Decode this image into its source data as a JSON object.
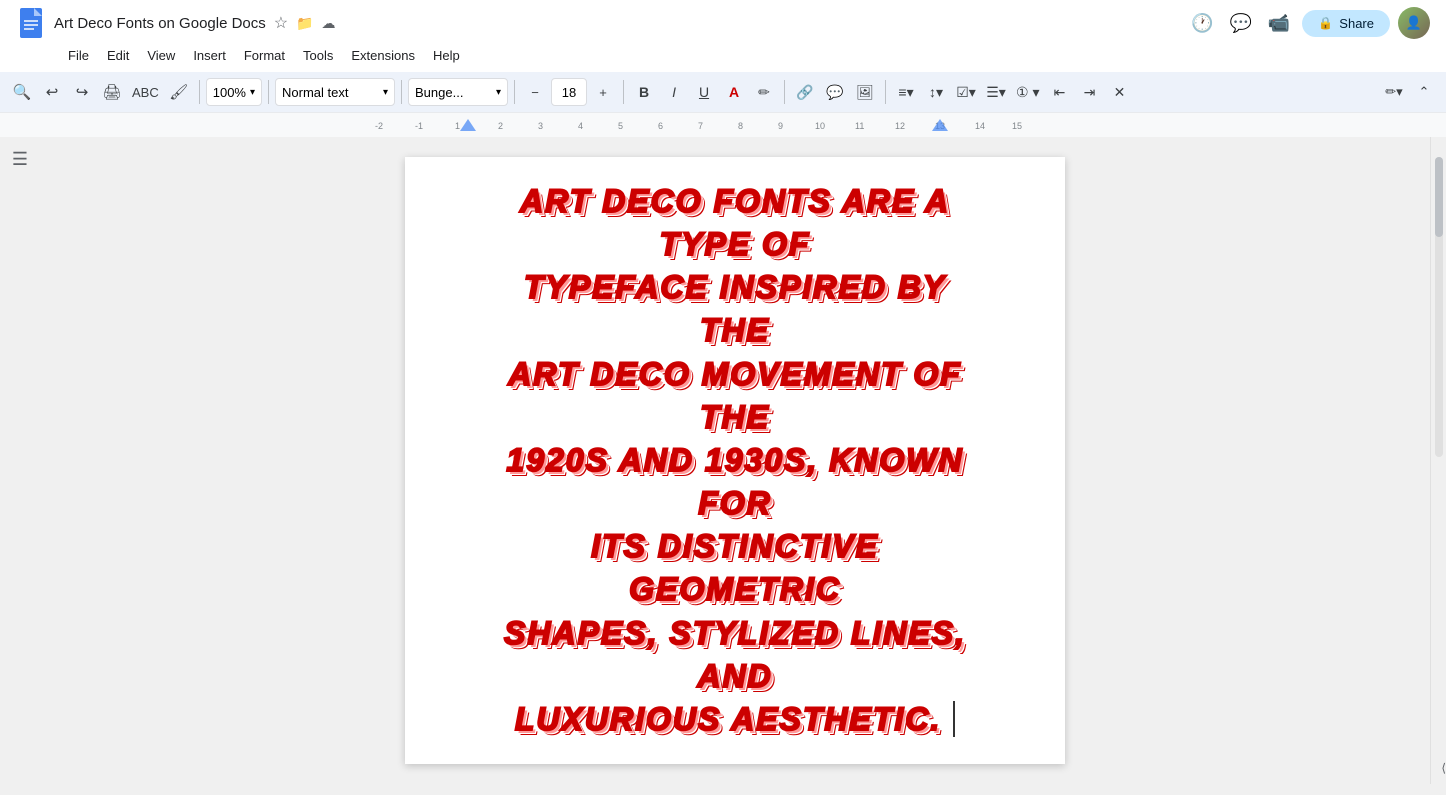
{
  "header": {
    "doc_title": "Art Deco Fonts on Google Docs",
    "star_icon": "★",
    "folder_icon": "⊘",
    "cloud_icon": "☁"
  },
  "menu": {
    "items": [
      "File",
      "Edit",
      "View",
      "Insert",
      "Format",
      "Tools",
      "Extensions",
      "Help"
    ]
  },
  "toolbar": {
    "undo_label": "↩",
    "redo_label": "↪",
    "print_label": "🖨",
    "paint_format_label": "🖌",
    "zoom_label": "100%",
    "style_label": "Normal text",
    "font_label": "Bunge...",
    "font_size": "18",
    "bold_label": "B",
    "italic_label": "I",
    "underline_label": "U",
    "share_label": "Share"
  },
  "document": {
    "content": "Art Deco Fonts are a type of typeface inspired by the Art Deco movement of the 1920s and 1930s, known for its distinctive geometric shapes, stylized lines, and luxurious aesthetic."
  },
  "art_deco_lines": [
    "ART DECO FONTS ARE A TYPE OF",
    "TYPEFACE INSPIRED BY THE",
    "ART DECO MOVEMENT OF THE",
    "1920S AND 1930S, KNOWN FOR",
    "ITS DISTINCTIVE GEOMETRIC",
    "SHAPES, STYLIZED LINES, AND",
    "LUXURIOUS AESTHETIC."
  ]
}
